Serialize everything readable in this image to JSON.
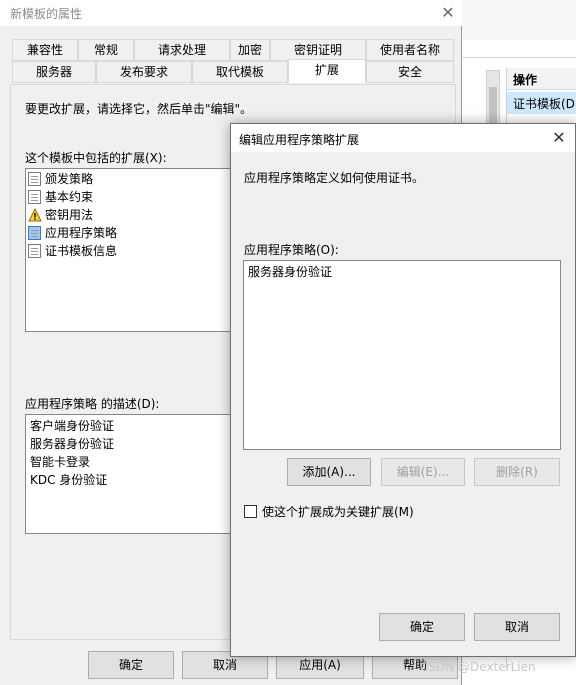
{
  "background_window": {
    "actions_header": "操作",
    "actions_item": "证书模板(D"
  },
  "properties_dialog": {
    "title": "新模板的属性",
    "tabs_row1": [
      "兼容性",
      "常规",
      "请求处理",
      "加密",
      "密钥证明",
      "使用者名称"
    ],
    "tabs_row2": [
      "服务器",
      "发布要求",
      "取代模板",
      "扩展",
      "安全"
    ],
    "active_tab": "扩展",
    "instruction": "要更改扩展，请选择它，然后单击\"编辑\"。",
    "extensions_label": "这个模板中包括的扩展(X):",
    "extensions": [
      {
        "label": "颁发策略",
        "icon": "document-icon"
      },
      {
        "label": "基本约束",
        "icon": "document-icon"
      },
      {
        "label": "密钥用法",
        "icon": "warning-icon"
      },
      {
        "label": "应用程序策略",
        "icon": "document-selected-icon"
      },
      {
        "label": "证书模板信息",
        "icon": "document-icon"
      }
    ],
    "description_label": "应用程序策略 的描述(D):",
    "description_lines": [
      "客户端身份验证",
      "服务器身份验证",
      "智能卡登录",
      "KDC 身份验证"
    ],
    "buttons": {
      "ok": "确定",
      "cancel": "取消",
      "apply": "应用(A)",
      "help": "帮助"
    }
  },
  "edit_dialog": {
    "title": "编辑应用程序策略扩展",
    "description": "应用程序策略定义如何使用证书。",
    "policies_label": "应用程序策略(O):",
    "policies": [
      "服务器身份验证"
    ],
    "add_button": "添加(A)...",
    "edit_button": "编辑(E)...",
    "remove_button": "删除(R)",
    "critical_checkbox_label": "使这个扩展成为关键扩展(M)",
    "critical_checked": false,
    "ok_button": "确定",
    "cancel_button": "取消"
  },
  "watermark": "CSDN @DexterLien"
}
